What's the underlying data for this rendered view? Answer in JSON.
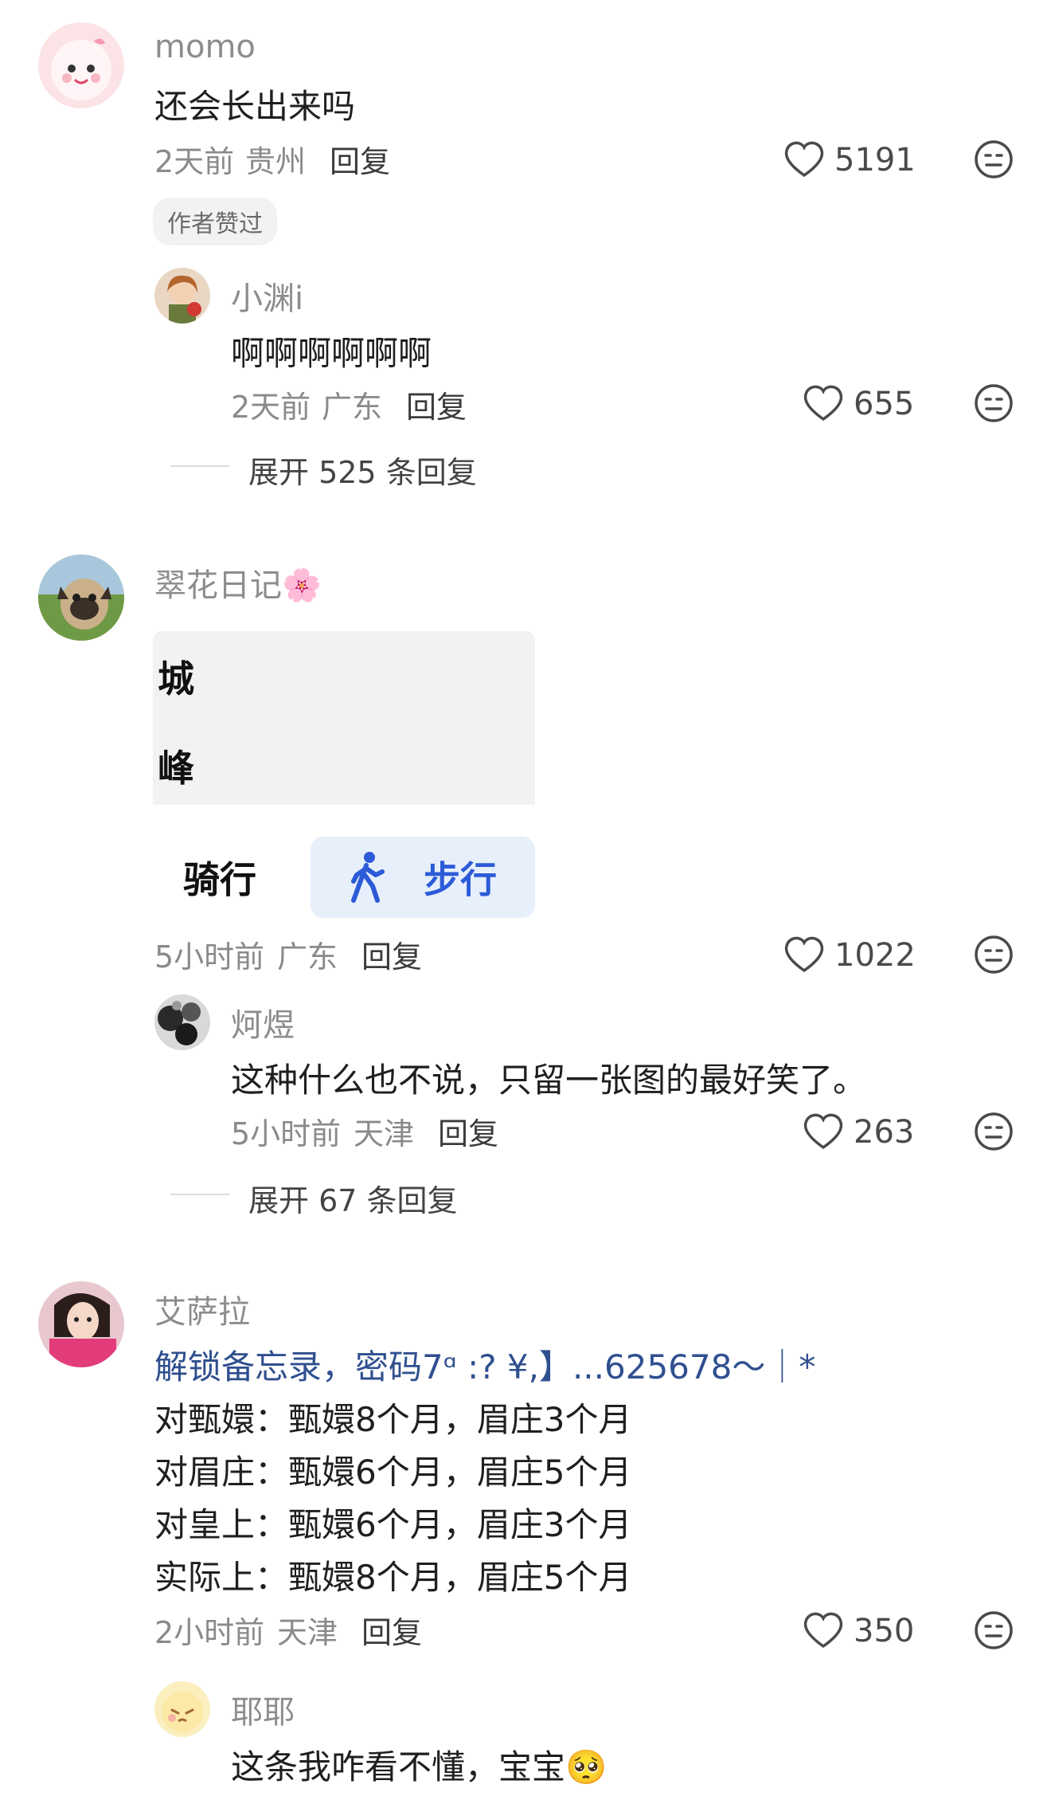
{
  "comments": [
    {
      "user": "momo",
      "text": "还会长出来吗",
      "time": "2天前",
      "location": "贵州",
      "reply_label": "回复",
      "likes": "5191",
      "tag": "作者赞过",
      "replies": [
        {
          "user": "小渊i",
          "text": "啊啊啊啊啊啊",
          "time": "2天前",
          "location": "广东",
          "reply_label": "回复",
          "likes": "655"
        }
      ],
      "expand_label": "展开 525 条回复"
    },
    {
      "user": "翠花日记🌸",
      "image": {
        "line1": "城",
        "line2": "峰",
        "mode_ride": "骑行",
        "mode_walk": "步行"
      },
      "time": "5小时前",
      "location": "广东",
      "reply_label": "回复",
      "likes": "1022",
      "replies": [
        {
          "user": "炣煜",
          "text": "这种什么也不说，只留一张图的最好笑了。",
          "time": "5小时前",
          "location": "天津",
          "reply_label": "回复",
          "likes": "263"
        }
      ],
      "expand_label": "展开 67 条回复"
    },
    {
      "user": "艾萨拉",
      "lines": [
        "解锁备忘录，密码7ᵅ :? ¥,】...625678～｜*",
        "对甄嬛：甄嬛8个月，眉庄3个月",
        "对眉庄：甄嬛6个月，眉庄5个月",
        "对皇上：甄嬛6个月，眉庄3个月",
        "实际上：甄嬛8个月，眉庄5个月"
      ],
      "time": "2小时前",
      "location": "天津",
      "reply_label": "回复",
      "likes": "350",
      "replies": [
        {
          "user": "耶耶",
          "text": "这条我咋看不懂，宝宝🥺"
        }
      ]
    }
  ],
  "colors": {
    "link_blue": "#2f4f8f",
    "walk_blue": "#2c5bd8",
    "walk_bg": "#e7effb"
  }
}
